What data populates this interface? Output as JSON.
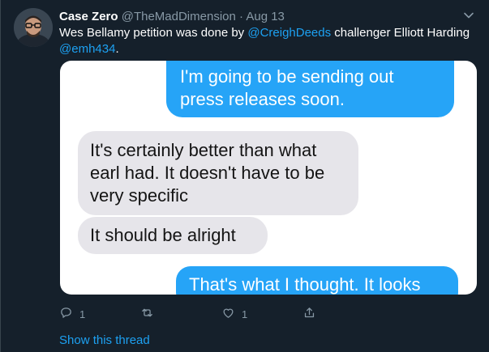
{
  "tweet": {
    "author_name": "Case Zero",
    "author_handle": "@TheMadDimension",
    "separator": "·",
    "date": "Aug 13",
    "text_part1": "Wes Bellamy petition was done by ",
    "mention1": "@CreighDeeds",
    "text_part2": " challenger Elliott Harding ",
    "mention2": "@emh434",
    "text_part3": "."
  },
  "media": {
    "messages": [
      {
        "from": "me",
        "text": "I'm going to be sending out press releases soon."
      },
      {
        "from": "them",
        "text": "It's certainly better than what earl had. It doesn't have to be very specific"
      },
      {
        "from": "them",
        "text": "It should be alright"
      },
      {
        "from": "me",
        "text": "That's what I thought. It looks"
      }
    ]
  },
  "actions": {
    "reply_count": "1",
    "retweet_count": "",
    "like_count": "1"
  },
  "show_thread_label": "Show this thread",
  "colors": {
    "background": "#15202b",
    "link": "#1da1f2",
    "muted": "#8899a6",
    "imessage_blue": "#26a4f7",
    "imessage_gray": "#e6e5ea"
  }
}
